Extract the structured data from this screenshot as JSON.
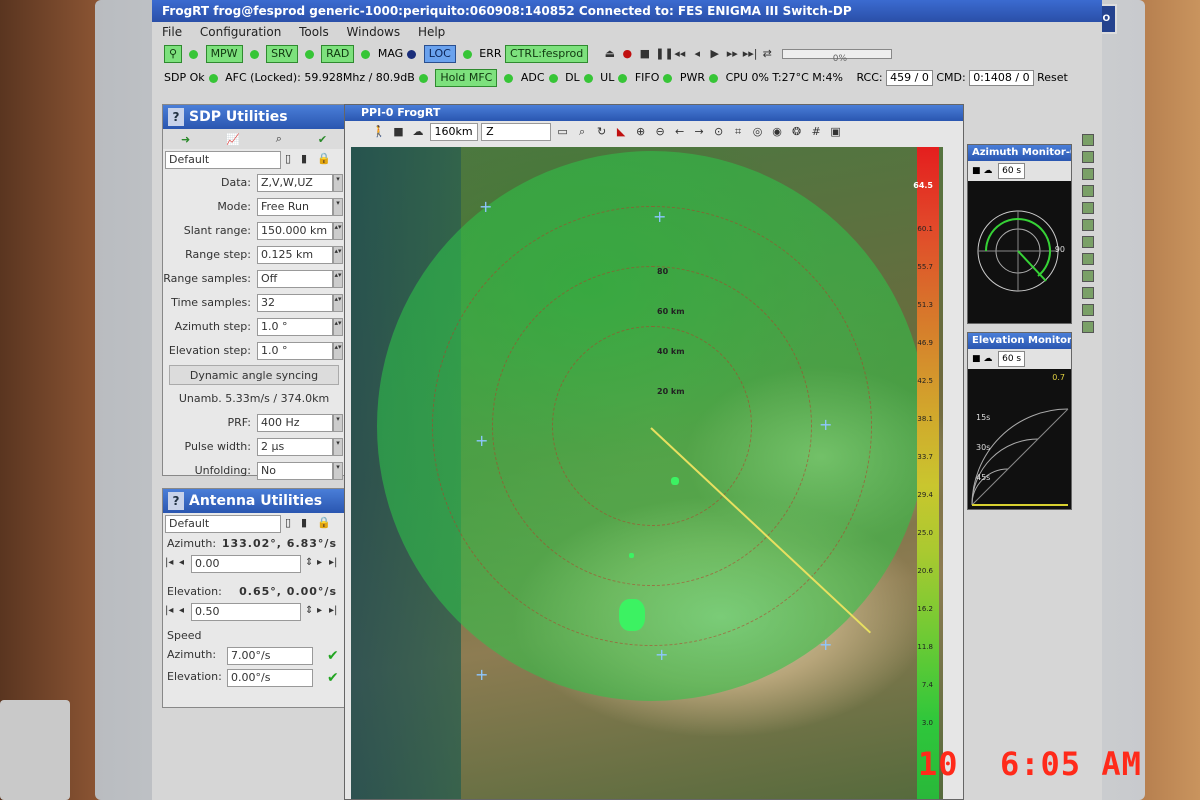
{
  "window": {
    "title": "FrogRT frog@fesprod generic-1000:periquito:060908:140852 Connected to: FES ENIGMA III Switch-DP"
  },
  "menu": [
    "File",
    "Configuration",
    "Tools",
    "Windows",
    "Help"
  ],
  "toolbar1": {
    "buttons": [
      "MPW",
      "SRV",
      "RAD",
      "LOC",
      "CTRL:fesprod"
    ],
    "indicators": [
      "MAG",
      "ERR"
    ],
    "progress_text": "0%"
  },
  "toolbar2": {
    "sdp_status": "SDP Ok",
    "afc_status": "AFC (Locked): 59.928Mhz / 80.9dB",
    "hold_mfc_label": "Hold MFC",
    "indicators": [
      "ADC",
      "DL",
      "UL",
      "FIFO",
      "PWR"
    ],
    "cpu_text": "CPU",
    "cpu_value": "0% T:27°C M:4%",
    "rcc_label": "RCC:",
    "rcc_value": "459 / 0",
    "cmd_label": "CMD:",
    "cmd_value": "0:1408 / 0",
    "reset_label": "Reset"
  },
  "sdp_panel": {
    "title": "SDP Utilities",
    "preset": "Default",
    "fields": [
      {
        "label": "Data:",
        "value": "Z,V,W,UZ"
      },
      {
        "label": "Mode:",
        "value": "Free Run"
      },
      {
        "label": "Slant range:",
        "value": "150.000 km"
      },
      {
        "label": "Range step:",
        "value": "0.125 km"
      },
      {
        "label": "Range samples:",
        "value": "Off"
      },
      {
        "label": "Time samples:",
        "value": "32"
      },
      {
        "label": "Azimuth step:",
        "value": "1.0 °"
      },
      {
        "label": "Elevation step:",
        "value": "1.0 °"
      }
    ],
    "section": "Dynamic angle syncing",
    "unamb": "Unamb. 5.33m/s / 374.0km",
    "fields2": [
      {
        "label": "PRF:",
        "value": "400 Hz"
      },
      {
        "label": "Pulse width:",
        "value": "2 μs"
      },
      {
        "label": "Unfolding:",
        "value": "No"
      }
    ]
  },
  "antenna_panel": {
    "title": "Antenna Utilities",
    "preset": "Default",
    "azimuth_label": "Azimuth:",
    "azimuth_value": "133.02°, 6.83°/s",
    "azimuth_input": "0.00",
    "elevation_label": "Elevation:",
    "elevation_value": "0.65°, 0.00°/s",
    "elevation_input": "0.50",
    "speed_label": "Speed",
    "speed_azimuth_label": "Azimuth:",
    "speed_azimuth_value": "7.00°/s",
    "speed_elevation_label": "Elevation:",
    "speed_elevation_value": "0.00°/s"
  },
  "ppi": {
    "title": "PPI-0 FrogRT",
    "range": "160km",
    "product": "Z",
    "ring_labels": [
      "80",
      "60 km",
      "40 km",
      "20 km"
    ],
    "colorbar_top": "64.5",
    "colorbar_labels": [
      "60.1",
      "55.7",
      "51.3",
      "46.9",
      "42.5",
      "38.1",
      "33.7",
      "29.4",
      "25.0",
      "20.6",
      "16.2",
      "11.8",
      "7.4",
      "3.0"
    ],
    "sweep_azimuth_deg": 133.02
  },
  "monitors": {
    "azimuth": {
      "title": "Azimuth Monitor-0",
      "interval": "60 s",
      "label_right": "90"
    },
    "elevation": {
      "title": "Elevation Monitor-0",
      "interval": "60 s",
      "value": "0.7",
      "ticks": [
        "15s",
        "30s",
        "45s"
      ]
    }
  },
  "camera_stamp": {
    "day": "10",
    "time": "6:05 AM"
  },
  "colors": {
    "accent": "#2a56b0",
    "button_green": "#7de17d",
    "led_green": "#37c537",
    "stamp_red": "#ff2a1a"
  }
}
